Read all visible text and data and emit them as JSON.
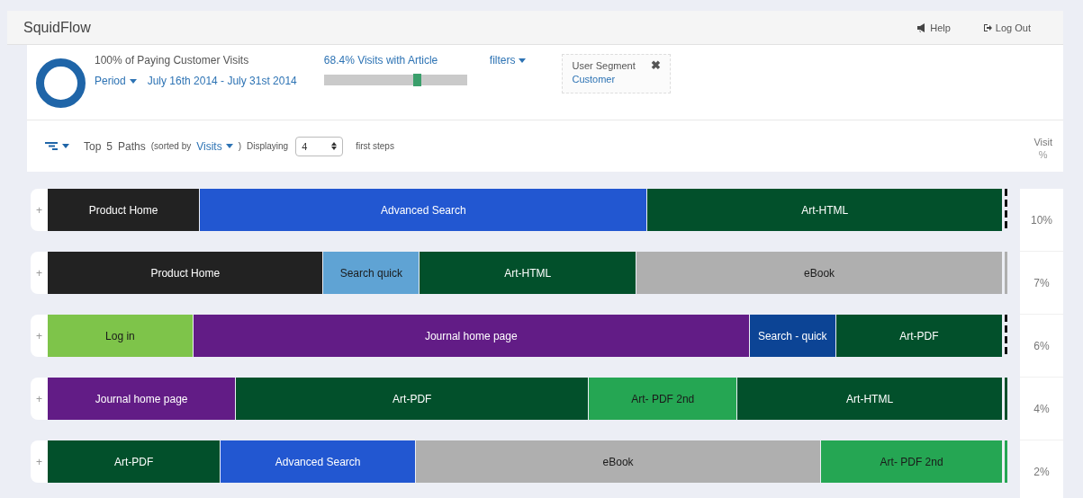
{
  "app": {
    "title": "SquidFlow",
    "nav": [
      {
        "kind": "help",
        "label": "Help"
      },
      {
        "kind": "logout",
        "label": "Log Out"
      }
    ]
  },
  "summary": {
    "headline": "100% of Paying Customer Visits",
    "period_label": "Period",
    "period_value": "July 16th 2014 - July 31st 2014",
    "article_label": "68.4% Visits with Article",
    "article_slider": {
      "level": 0.65
    },
    "filters_label": "filters",
    "segment": {
      "label": "User Segment",
      "value": "Customer",
      "remove": "✖"
    }
  },
  "toolbar": {
    "top": "Top",
    "count": "5",
    "paths": "Paths",
    "sorted_by": "(sorted by",
    "sort_field": "Visits",
    "close_paren": ")",
    "displaying": "Displaying",
    "steps_value": "4",
    "steps_label": "first steps",
    "column_header_1": "Visit",
    "column_header_2": "%"
  },
  "paths": [
    {
      "kind": "dashed",
      "expand": "+",
      "visit": "10%",
      "steps": [
        {
          "label": "Product Home",
          "color": "#222222"
        },
        {
          "label": "Advanced Search",
          "color": "#2257d1"
        },
        {
          "label": "Art-HTML",
          "color": "#02502b"
        }
      ]
    },
    {
      "kind": "solid",
      "expand": "+",
      "visit": "7%",
      "steps": [
        {
          "label": "Product Home",
          "color": "#222222"
        },
        {
          "label": "Search quick",
          "color": "#5fa3d4"
        },
        {
          "label": "Art-HTML",
          "color": "#02502b"
        },
        {
          "label": "eBook",
          "color": "#afafaf"
        }
      ]
    },
    {
      "kind": "dashed",
      "expand": "+",
      "visit": "6%",
      "steps": [
        {
          "label": "Log in",
          "color": "#7ec44a"
        },
        {
          "label": "Journal home page",
          "color": "#621c86"
        },
        {
          "label": "Search - quick",
          "color": "#0c4495"
        },
        {
          "label": "Art-PDF",
          "color": "#02502b"
        }
      ]
    },
    {
      "kind": "solid",
      "expand": "+",
      "visit": "4%",
      "steps": [
        {
          "label": "Journal home page",
          "color": "#621c86"
        },
        {
          "label": "Art-PDF",
          "color": "#02502b"
        },
        {
          "label": "Art- PDF 2nd",
          "color": "#25a653"
        },
        {
          "label": "Art-HTML",
          "color": "#02502b"
        }
      ]
    },
    {
      "kind": "solid",
      "expand": "+",
      "visit": "2%",
      "steps": [
        {
          "label": "Art-PDF",
          "color": "#02502b"
        },
        {
          "label": "Advanced Search",
          "color": "#2257d1"
        },
        {
          "label": "eBook",
          "color": "#afafaf"
        },
        {
          "label": "Art- PDF 2nd",
          "color": "#25a653"
        }
      ]
    }
  ]
}
